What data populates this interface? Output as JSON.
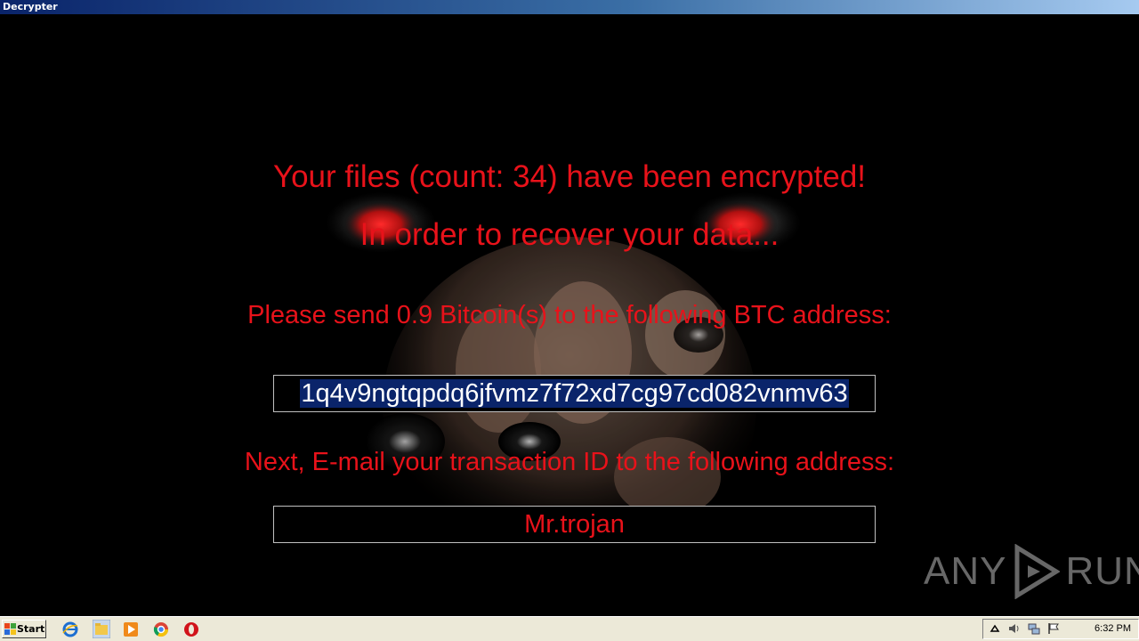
{
  "window": {
    "title": "Decrypter"
  },
  "ransom": {
    "headline": "Your files (count: 34) have been encrypted!",
    "subhead": "In order to recover your data...",
    "instruction_pay": "Please send 0.9 Bitcoin(s) to the following BTC address:",
    "btc_address": "1q4v9ngtqpdq6jfvmz7f72xd7cg97cd082vnmv63",
    "instruction_email": "Next, E-mail your transaction ID to the following address:",
    "email_address": "Mr.trojan"
  },
  "watermark": {
    "left": "ANY",
    "right": "RUN"
  },
  "taskbar": {
    "start_label": "Start",
    "quicklaunch": [
      "internet-explorer-icon",
      "explorer-folder-icon",
      "media-player-icon",
      "chrome-icon",
      "opera-icon"
    ],
    "tray": {
      "time": "6:32 PM",
      "icons": [
        "show-hidden-icons-icon",
        "volume-icon",
        "network-icon",
        "action-center-flag-icon"
      ]
    }
  },
  "colors": {
    "message_red": "#e8121a",
    "selection_blue": "#0a246a",
    "background": "#000000",
    "taskbar": "#ece9d8"
  }
}
